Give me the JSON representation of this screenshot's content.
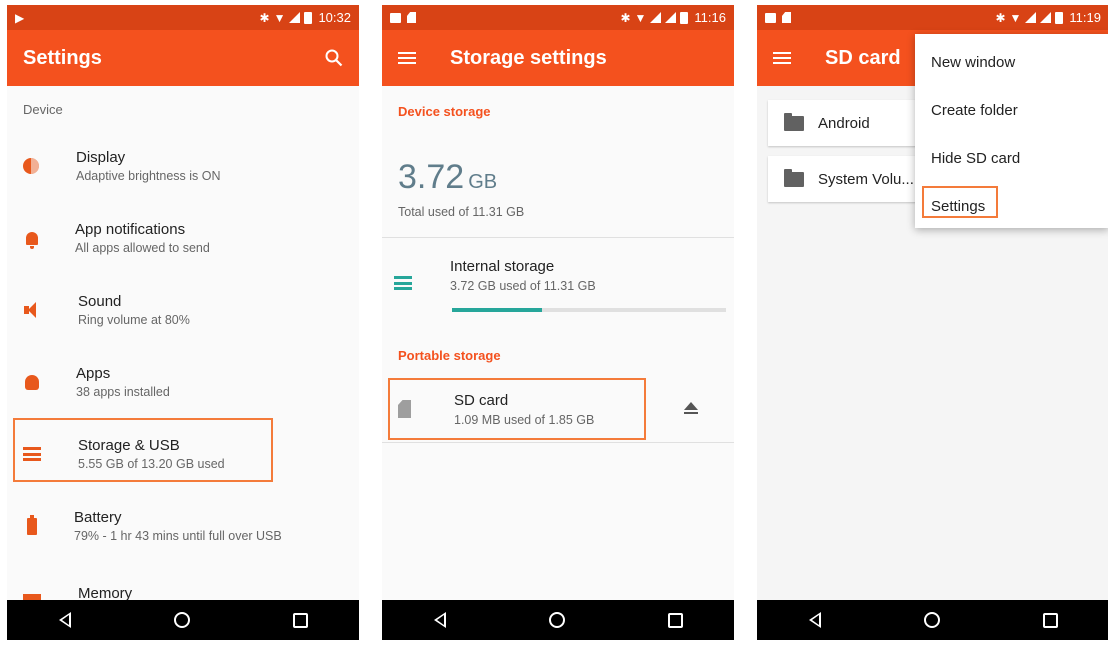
{
  "colors": {
    "accent": "#f4511e",
    "statusbar": "#d84315",
    "teal": "#26a69a",
    "highlight": "#f47b3a"
  },
  "screens": [
    {
      "time": "10:32",
      "appbar_title": "Settings",
      "section": "Device",
      "items": [
        {
          "title": "Display",
          "subtitle": "Adaptive brightness is ON",
          "icon": "display-icon"
        },
        {
          "title": "App notifications",
          "subtitle": "All apps allowed to send",
          "icon": "bell-icon"
        },
        {
          "title": "Sound",
          "subtitle": "Ring volume at 80%",
          "icon": "volume-icon"
        },
        {
          "title": "Apps",
          "subtitle": "38 apps installed",
          "icon": "android-icon"
        },
        {
          "title": "Storage & USB",
          "subtitle": "5.55 GB of 13.20 GB used",
          "icon": "storage-icon"
        },
        {
          "title": "Battery",
          "subtitle": "79% - 1 hr 43 mins until full over USB",
          "icon": "battery-icon"
        },
        {
          "title": "Memory",
          "subtitle": "",
          "icon": "memory-icon"
        }
      ]
    },
    {
      "time": "11:16",
      "appbar_title": "Storage settings",
      "device_storage_label": "Device storage",
      "used_number": "3.72",
      "used_unit": "GB",
      "total_used": "Total used of 11.31 GB",
      "internal": {
        "title": "Internal storage",
        "subtitle": "3.72 GB used of 11.31 GB",
        "fraction": 0.329
      },
      "portable_storage_label": "Portable storage",
      "sd": {
        "title": "SD card",
        "subtitle": "1.09 MB used of 1.85 GB"
      }
    },
    {
      "time": "11:19",
      "appbar_title": "SD card",
      "folders": [
        "Android",
        "System Volu..."
      ],
      "menu": [
        "New window",
        "Create folder",
        "Hide SD card",
        "Settings"
      ]
    }
  ]
}
